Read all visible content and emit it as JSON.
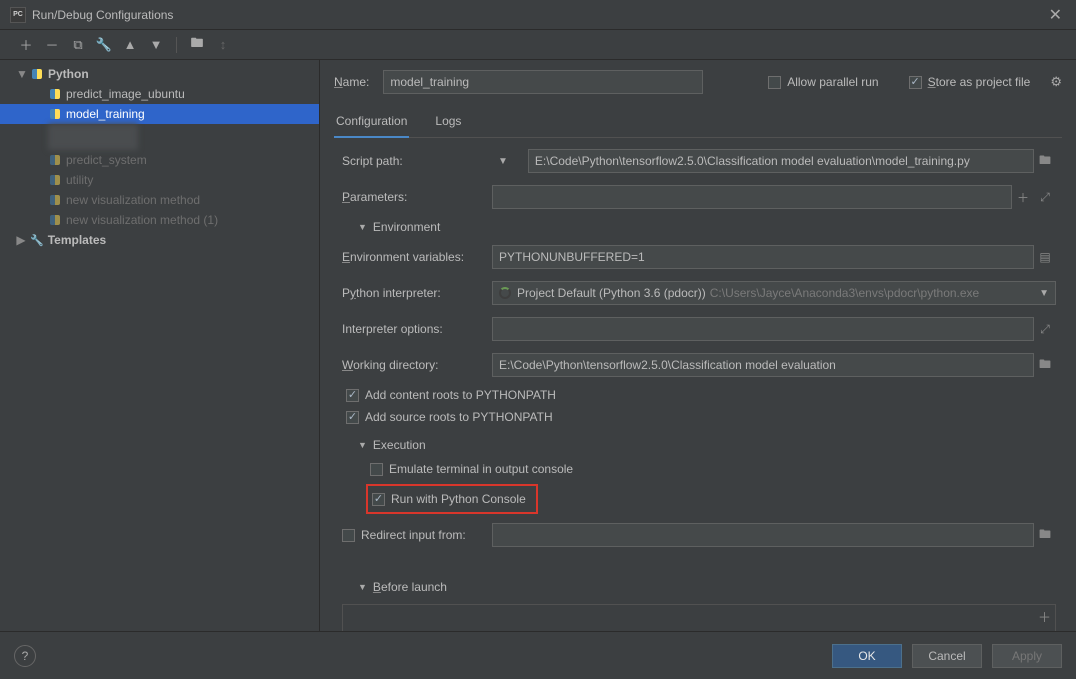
{
  "window": {
    "title": "Run/Debug Configurations"
  },
  "tree": {
    "python_group": "Python",
    "items": [
      "predict_image_ubuntu",
      "model_training",
      "predict_system",
      "utility",
      "new visualization method",
      "new visualization method (1)"
    ],
    "templates": "Templates"
  },
  "name_row": {
    "label": "Name:",
    "value": "model_training",
    "allow_parallel": "Allow parallel run",
    "store_as_file": "Store as project file"
  },
  "tabs": {
    "config": "Configuration",
    "logs": "Logs"
  },
  "fields": {
    "script_path_label": "Script path:",
    "script_path_value": "E:\\Code\\Python\\tensorflow2.5.0\\Classification model evaluation\\model_training.py",
    "parameters_label": "Parameters:",
    "parameters_value": "",
    "env_section": "Environment",
    "env_vars_label": "Environment variables:",
    "env_vars_value": "PYTHONUNBUFFERED=1",
    "interpreter_label": "Python interpreter:",
    "interpreter_value": "Project Default (Python 3.6 (pdocr))",
    "interpreter_path": "C:\\Users\\Jayce\\Anaconda3\\envs\\pdocr\\python.exe",
    "interp_opts_label": "Interpreter options:",
    "interp_opts_value": "",
    "workdir_label": "Working directory:",
    "workdir_value": "E:\\Code\\Python\\tensorflow2.5.0\\Classification model evaluation",
    "add_content_roots": "Add content roots to PYTHONPATH",
    "add_source_roots": "Add source roots to PYTHONPATH",
    "exec_section": "Execution",
    "emulate_terminal": "Emulate terminal in output console",
    "run_with_console": "Run with Python Console",
    "redirect_input": "Redirect input from:",
    "redirect_input_value": "",
    "before_launch": "Before launch"
  },
  "footer": {
    "ok": "OK",
    "cancel": "Cancel",
    "apply": "Apply"
  }
}
